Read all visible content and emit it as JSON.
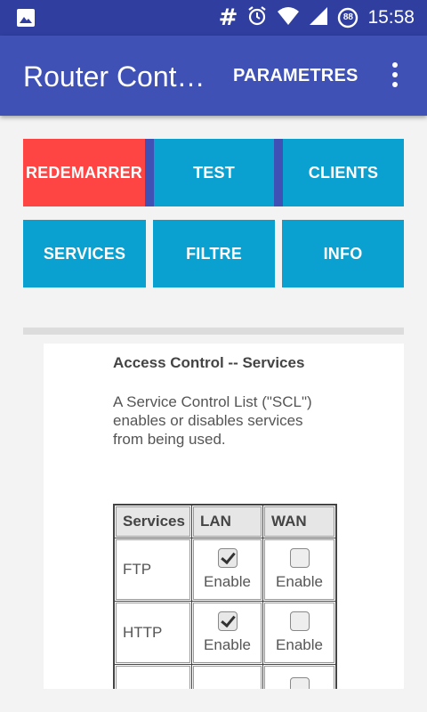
{
  "status_bar": {
    "time": "15:58",
    "hash_glyph": "#",
    "badge": "88",
    "icons": [
      "image-icon",
      "hash-icon",
      "alarm-icon",
      "wifi-icon",
      "signal-icon",
      "data-saver-icon"
    ]
  },
  "app_bar": {
    "title": "Router Cont…",
    "action": "PARAMETRES",
    "menu_icon": "overflow-menu-icon"
  },
  "buttons": {
    "restart": "REDEMARRER",
    "test": "TEST",
    "clients": "CLIENTS",
    "services": "SERVICES",
    "filter": "FILTRE",
    "info": "INFO"
  },
  "colors": {
    "status_bar": "#303f9f",
    "app_bar": "#3f51b5",
    "button_blue": "#0aa0d0",
    "button_red": "#ff4444"
  },
  "web": {
    "heading": "Access Control -- Services",
    "description": "A Service Control List (\"SCL\") enables or disables services from being used.",
    "table": {
      "headers": [
        "Services",
        "LAN",
        "WAN"
      ],
      "rows": [
        {
          "service": "FTP",
          "lan_label": "Enable",
          "lan_checked": true,
          "wan_label": "Enable",
          "wan_checked": false
        },
        {
          "service": "HTTP",
          "lan_label": "Enable",
          "lan_checked": true,
          "wan_label": "Enable",
          "wan_checked": false
        }
      ]
    }
  }
}
